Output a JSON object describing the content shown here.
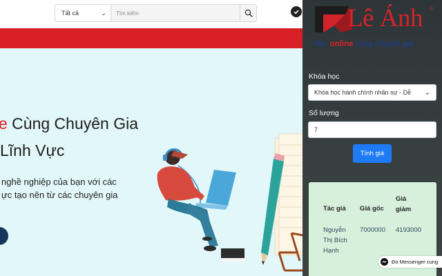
{
  "site": {
    "search": {
      "category_value": "Tất cả",
      "placeholder": "Tìm kiếm"
    },
    "hero": {
      "title_accent": "e",
      "title_line1": " Cùng Chuyên Gia",
      "title_line2": " Lĩnh Vực",
      "subtitle_line1": "nghề nghiệp của bạn với các",
      "subtitle_line2": "ực tạo nên từ các chuyên gia"
    },
    "messenger_label": "Đo Messenger cung"
  },
  "extension": {
    "logo": {
      "title": "Lê Ánh",
      "registered": "®",
      "tagline_prefix": "Học ",
      "tagline_online": "online",
      "tagline_suffix": " cùng chuyên gia"
    },
    "course_label": "Khóa học",
    "course_selected": "Khóa học hành chính nhân sự - Dễ",
    "quantity_label": "Số lượng",
    "quantity_value": "7",
    "calc_button": "Tính giá",
    "result": {
      "headers": {
        "author": "Tác giả",
        "original_price": "Giá gốc",
        "discount_price_1": "Giá",
        "discount_price_2": "giảm"
      },
      "row": {
        "author_lines": [
          "Nguyễn",
          "Thị Bích",
          "Hạnh"
        ],
        "original_price": "7000000",
        "discount_price": "4193000"
      }
    }
  },
  "colors": {
    "brand_red": "#d81f26",
    "hero_bg": "#e1f7fa",
    "panel_bg": "#353c3e",
    "button_blue": "#1e7bf5",
    "result_bg": "#d6f0dc"
  },
  "icons": [
    "chevron-down-icon",
    "search-icon",
    "verified-check-icon",
    "messenger-icon",
    "le-anh-logo-icon"
  ]
}
